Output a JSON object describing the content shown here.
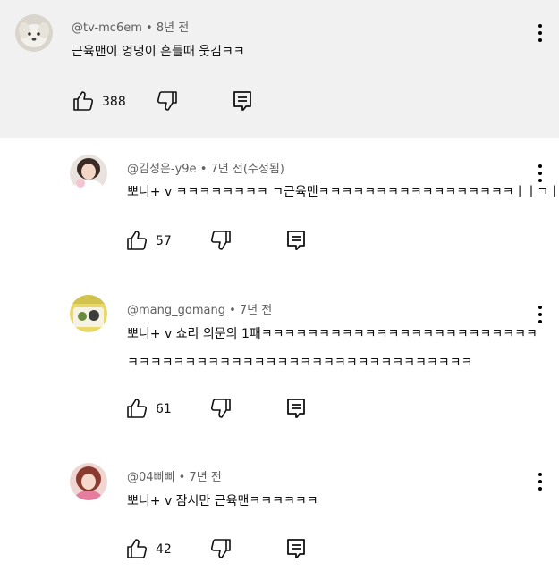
{
  "comments": [
    {
      "author": "@tv-mc6em",
      "time": "8년 전",
      "text_lines": [
        "근육맨이 엉덩이 흔들때 웃김ㅋㅋ"
      ],
      "likes": "388"
    },
    {
      "author": "@김성은-y9e",
      "time": "7년 전(수정됨)",
      "text_lines": [
        "뽀니+ v ㅋㅋㅋㅋㅋㅋㅋㅋ ㄱ근육맨ㅋㅋㅋㅋㅋㅋㅋㅋㅋㅋㅋㅋㅋㅋㅋㅋㅋㅣㅣㄱㅣ"
      ],
      "likes": "57"
    },
    {
      "author": "@mang_gomang",
      "time": "7년 전",
      "text_lines": [
        "뽀니+ v 쇼리 의문의 1패ㅋㅋㅋㅋㅋㅋㅋㅋㅋㅋㅋㅋㅋㅋㅋㅋㅋㅋㅋㅋㅋㅋㅋㅋㅋㅋㅋㅋㅋㅋ",
        "ㅋㅋㅋㅋㅋㅋㅋㅋㅋㅋㅋㅋㅋㅋㅋㅋㅋㅋㅋㅋㅋㅋㅋㅋㅋㅋㅋㅋㅋㅋ"
      ],
      "likes": "61"
    },
    {
      "author": "@04삐삐",
      "time": "7년 전",
      "text_lines": [
        "뽀니+ v 잠시만 근육맨ㅋㅋㅋㅋㅋㅋ"
      ],
      "likes": "42"
    }
  ],
  "icons": {
    "like": "thumb-up-icon",
    "dislike": "thumb-down-icon",
    "reply": "reply-icon",
    "more": "more-vert-icon"
  },
  "colors": {
    "top_comment_background": "#f1f1f1",
    "meta_text": "#606060"
  }
}
